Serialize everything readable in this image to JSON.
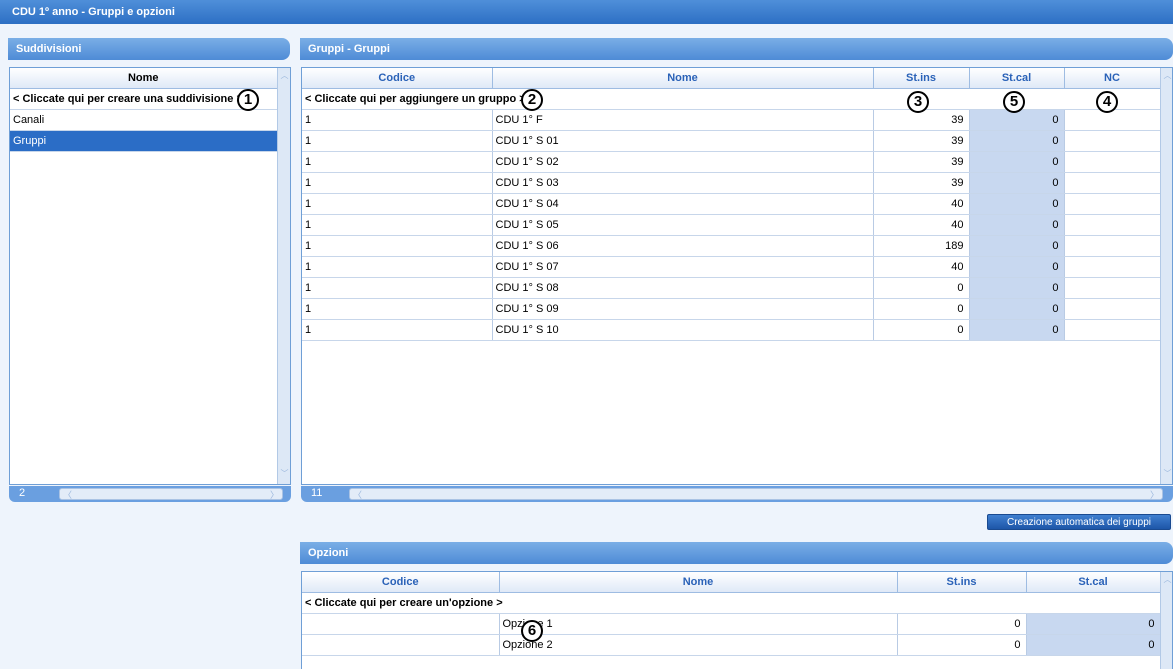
{
  "window": {
    "title": "CDU 1º anno - Gruppi e opzioni"
  },
  "suddivisioni": {
    "header": "Suddivisioni",
    "column_nome": "Nome",
    "create_row": "< Cliccate qui per creare una suddivisione >",
    "items": [
      {
        "label": "Canali",
        "selected": false
      },
      {
        "label": "Gruppi",
        "selected": true
      }
    ],
    "count": "2"
  },
  "gruppi": {
    "header": "Gruppi - Gruppi",
    "columns": [
      "Codice",
      "Nome",
      "St.ins",
      "St.cal",
      "NC"
    ],
    "create_row": "< Cliccate qui per aggiungere un gruppo >",
    "rows": [
      {
        "codice": "1",
        "nome": "CDU 1° F",
        "st_ins": "39",
        "st_cal": "0",
        "nc": ""
      },
      {
        "codice": "1",
        "nome": "CDU 1° S 01",
        "st_ins": "39",
        "st_cal": "0",
        "nc": ""
      },
      {
        "codice": "1",
        "nome": "CDU 1° S 02",
        "st_ins": "39",
        "st_cal": "0",
        "nc": ""
      },
      {
        "codice": "1",
        "nome": "CDU 1° S 03",
        "st_ins": "39",
        "st_cal": "0",
        "nc": ""
      },
      {
        "codice": "1",
        "nome": "CDU 1° S 04",
        "st_ins": "40",
        "st_cal": "0",
        "nc": ""
      },
      {
        "codice": "1",
        "nome": "CDU 1° S 05",
        "st_ins": "40",
        "st_cal": "0",
        "nc": ""
      },
      {
        "codice": "1",
        "nome": "CDU 1° S 06",
        "st_ins": "189",
        "st_cal": "0",
        "nc": ""
      },
      {
        "codice": "1",
        "nome": "CDU 1° S 07",
        "st_ins": "40",
        "st_cal": "0",
        "nc": ""
      },
      {
        "codice": "1",
        "nome": "CDU 1° S 08",
        "st_ins": "0",
        "st_cal": "0",
        "nc": ""
      },
      {
        "codice": "1",
        "nome": "CDU 1° S 09",
        "st_ins": "0",
        "st_cal": "0",
        "nc": ""
      },
      {
        "codice": "1",
        "nome": "CDU 1° S 10",
        "st_ins": "0",
        "st_cal": "0",
        "nc": ""
      }
    ],
    "count": "11",
    "auto_button": "Creazione automatica dei gruppi"
  },
  "opzioni": {
    "header": "Opzioni",
    "columns": [
      "Codice",
      "Nome",
      "St.ins",
      "St.cal"
    ],
    "create_row": "< Cliccate qui per creare un'opzione >",
    "rows": [
      {
        "codice": "",
        "nome": "Opzione 1",
        "st_ins": "0",
        "st_cal": "0"
      },
      {
        "codice": "",
        "nome": "Opzione 2",
        "st_ins": "0",
        "st_cal": "0"
      }
    ]
  },
  "annotations": [
    "1",
    "2",
    "3",
    "4",
    "5",
    "6"
  ]
}
